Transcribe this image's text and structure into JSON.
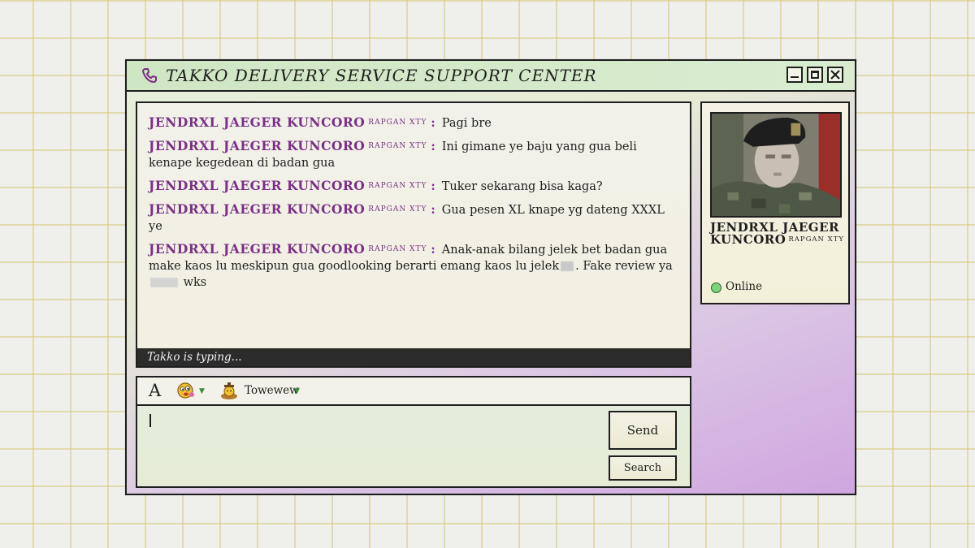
{
  "window": {
    "title": "TAKKO DELIVERY SERVICE SUPPORT CENTER"
  },
  "chat": {
    "messages": [
      {
        "sender": "JENDRXL JAEGER KUNCORO",
        "tag": "RAPGAN XTY",
        "text": "Pagi bre"
      },
      {
        "sender": "JENDRXL JAEGER KUNCORO",
        "tag": "RAPGAN XTY",
        "text": "Ini gimane ye baju yang gua beli kenape kegedean di badan gua"
      },
      {
        "sender": "JENDRXL JAEGER KUNCORO",
        "tag": "RAPGAN XTY",
        "text": "Tuker sekarang bisa kaga?"
      },
      {
        "sender": "JENDRXL JAEGER KUNCORO",
        "tag": "RAPGAN XTY",
        "text": "Gua pesen XL knape yg dateng XXXL ye"
      },
      {
        "sender": "JENDRXL JAEGER KUNCORO",
        "tag": "RAPGAN XTY",
        "text_part1": "Anak-anak bilang jelek bet badan gua make kaos lu meskipun gua goodlooking berarti emang kaos lu jelek",
        "text_part2": ". Fake review ya",
        "text_part3": "wks"
      }
    ],
    "typing_status": "Takko is typing..."
  },
  "toolbar": {
    "font_label": "A",
    "nudge_label": "Towewew"
  },
  "input": {
    "send_label": "Send",
    "search_label": "Search"
  },
  "profile": {
    "name": "JENDRXL JAEGER KUNCORO",
    "tag": "RAPGAN XTY",
    "status": "Online",
    "status_color": "#7fd37a"
  },
  "colors": {
    "username": "#7b2f86",
    "titlebar": "#d9ecd0",
    "window_gradient_end": "#cfa6e0"
  }
}
